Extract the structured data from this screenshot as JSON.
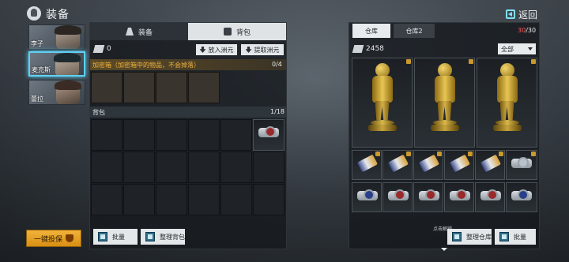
{
  "header": {
    "title": "装备",
    "back_label": "返回"
  },
  "characters": [
    {
      "name": "李子",
      "selected": false
    },
    {
      "name": "麦克斯",
      "selected": true
    },
    {
      "name": "蕾拉",
      "selected": false
    }
  ],
  "quick_insure_label": "一键投保",
  "left_panel": {
    "tabs": [
      {
        "label": "装备",
        "active": false
      },
      {
        "label": "背包",
        "active": true
      }
    ],
    "currency": "0",
    "deposit_label": "放入洲元",
    "withdraw_label": "提取洲元",
    "secure_box": {
      "title": "加密箱（加密箱中的物品，不会掉落）",
      "count": "0/4"
    },
    "backpack": {
      "title": "背包",
      "count": "1/18"
    },
    "batch_label": "批量",
    "sort_label": "整理背包"
  },
  "right_panel": {
    "tabs": [
      {
        "label": "仓库",
        "active": true
      },
      {
        "label": "仓库2",
        "active": false
      }
    ],
    "capacity_used": "30",
    "capacity_total": "/30",
    "currency": "2458",
    "filter_label": "全部",
    "lock_hint": "点击解锁",
    "sort_label": "整理仓库",
    "batch_label": "批量"
  },
  "colors": {
    "accent": "#5fd1f5",
    "quick_insure": "#f2b33a",
    "warning": "#f0b440",
    "capacity_full": "#ff5a5a"
  },
  "items": {
    "backpack": [
      "watch-red"
    ],
    "warehouse_row1": [
      "gold-statue",
      "gold-statue",
      "gold-statue"
    ],
    "warehouse_row2": [
      "ticket",
      "ticket",
      "ticket",
      "ticket",
      "ticket",
      "watch-silver"
    ],
    "warehouse_row3": [
      "watch-blue",
      "watch-red",
      "watch-red",
      "watch-red",
      "watch-red",
      "watch-blue"
    ]
  }
}
